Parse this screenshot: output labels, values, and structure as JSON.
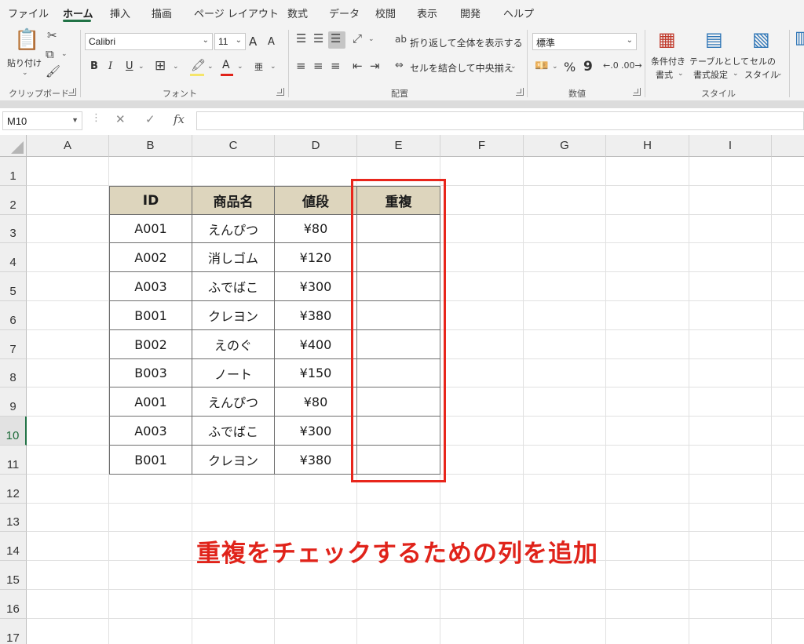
{
  "ribbon_tabs": [
    "ファイル",
    "ホーム",
    "挿入",
    "描画",
    "ページ レイアウト",
    "数式",
    "データ",
    "校閲",
    "表示",
    "開発",
    "ヘルプ"
  ],
  "active_tab": "ホーム",
  "clipboard": {
    "paste_label": "貼り付け",
    "group_label": "クリップボード"
  },
  "font": {
    "name": "Calibri",
    "size": "11",
    "group_label": "フォント",
    "bold": "B",
    "italic": "I",
    "underline": "U",
    "grow": "A",
    "shrink": "A",
    "font_color": "A",
    "phonetic": "亜"
  },
  "alignment": {
    "wrap_text": "折り返して全体を表示する",
    "merge_center": "セルを結合して中央揃え",
    "group_label": "配置"
  },
  "number": {
    "format": "標準",
    "group_label": "数値",
    "percent": "%",
    "comma": "9"
  },
  "styles": {
    "conditional_line1": "条件付き",
    "conditional_line2": "書式",
    "table_line1": "テーブルとして",
    "table_line2": "書式設定",
    "cell_line1": "セルの",
    "cell_line2": "スタイル",
    "group_label": "スタイル"
  },
  "formula_bar": {
    "name_box": "M10",
    "fx": "fx",
    "cancel": "✕",
    "enter": "✓",
    "formula": ""
  },
  "columns": [
    "A",
    "B",
    "C",
    "D",
    "E",
    "F",
    "G",
    "H",
    "I"
  ],
  "rows": [
    "1",
    "2",
    "3",
    "4",
    "5",
    "6",
    "7",
    "8",
    "9",
    "10",
    "11",
    "12",
    "13",
    "14",
    "15",
    "16",
    "17"
  ],
  "selected_row": "10",
  "table": {
    "headers": [
      "ID",
      "商品名",
      "値段",
      "重複"
    ],
    "rows": [
      [
        "A001",
        "えんぴつ",
        "¥80",
        ""
      ],
      [
        "A002",
        "消しゴム",
        "¥120",
        ""
      ],
      [
        "A003",
        "ふでばこ",
        "¥300",
        ""
      ],
      [
        "B001",
        "クレヨン",
        "¥380",
        ""
      ],
      [
        "B002",
        "えのぐ",
        "¥400",
        ""
      ],
      [
        "B003",
        "ノート",
        "¥150",
        ""
      ],
      [
        "A001",
        "えんぴつ",
        "¥80",
        ""
      ],
      [
        "A003",
        "ふでばこ",
        "¥300",
        ""
      ],
      [
        "B001",
        "クレヨン",
        "¥380",
        ""
      ]
    ],
    "header_color": "#ddd5bd"
  },
  "annotation": "重複をチェックするための列を追加",
  "colors": {
    "accent_green": "#217346",
    "annotation_red": "#e0231a"
  }
}
